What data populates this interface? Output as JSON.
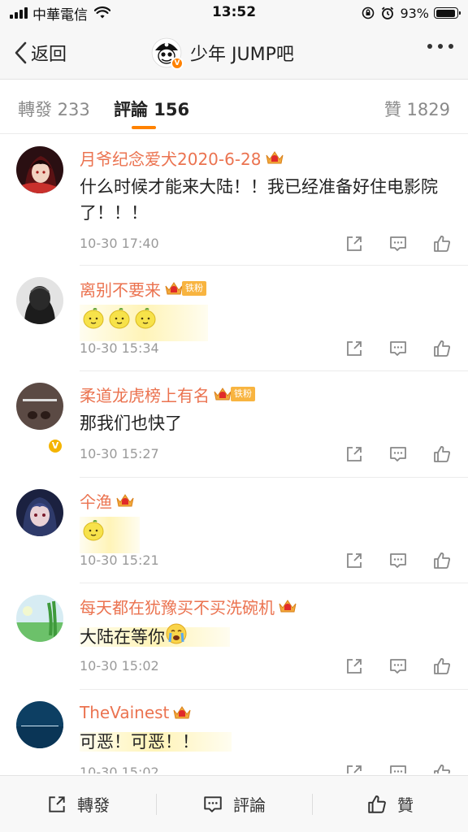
{
  "status_bar": {
    "carrier": "中華電信",
    "time": "13:52",
    "battery_percent": "93%",
    "battery_level": 0.93
  },
  "nav": {
    "back_label": "返回",
    "title": "少年 JUMP吧"
  },
  "tabs": [
    {
      "label": "轉發 233"
    },
    {
      "label": "評論 156"
    },
    {
      "label": "贊 1829"
    }
  ],
  "active_tab": "評論 156",
  "comments": [
    {
      "username": "月爷纪念爱犬2020-6-28",
      "badge": "crown",
      "text": "什么时候才能来大陆！！我已经准备好住电影院了！！！",
      "emoji_count": 0,
      "timestamp": "10-30 17:40"
    },
    {
      "username": "离别不要来",
      "badge": "fan",
      "fan_label": "铁粉",
      "fan_level": "3",
      "text": "",
      "emoji_count": 3,
      "emoji_name": "lemon-emoji",
      "timestamp": "10-30 15:34",
      "verified": true
    },
    {
      "username": "柔道龙虎榜上有名",
      "badge": "fan",
      "fan_label": "铁粉",
      "text": "那我们也快了",
      "emoji_count": 0,
      "timestamp": "10-30 15:27"
    },
    {
      "username": "仐渔",
      "badge": "crown",
      "text": "",
      "emoji_count": 1,
      "emoji_name": "lemon-emoji",
      "timestamp": "10-30 15:21"
    },
    {
      "username": "每天都在犹豫买不买洗碗机",
      "badge": "crown",
      "text": "大陆在等你",
      "emoji_count": 1,
      "emoji_name": "crying-emoji",
      "timestamp": "10-30 15:02"
    },
    {
      "username": "TheVainest",
      "badge": "crown",
      "text": "可恶！可恶！！",
      "emoji_count": 0,
      "timestamp": "10-30 15:02"
    }
  ],
  "bottom_bar": {
    "repost_label": "轉發",
    "comment_label": "評論",
    "like_label": "贊"
  },
  "colors": {
    "accent": "#ff8200",
    "username": "#eb7350",
    "highlight": "#fff3a8",
    "fan_badge": "#f8b440"
  }
}
